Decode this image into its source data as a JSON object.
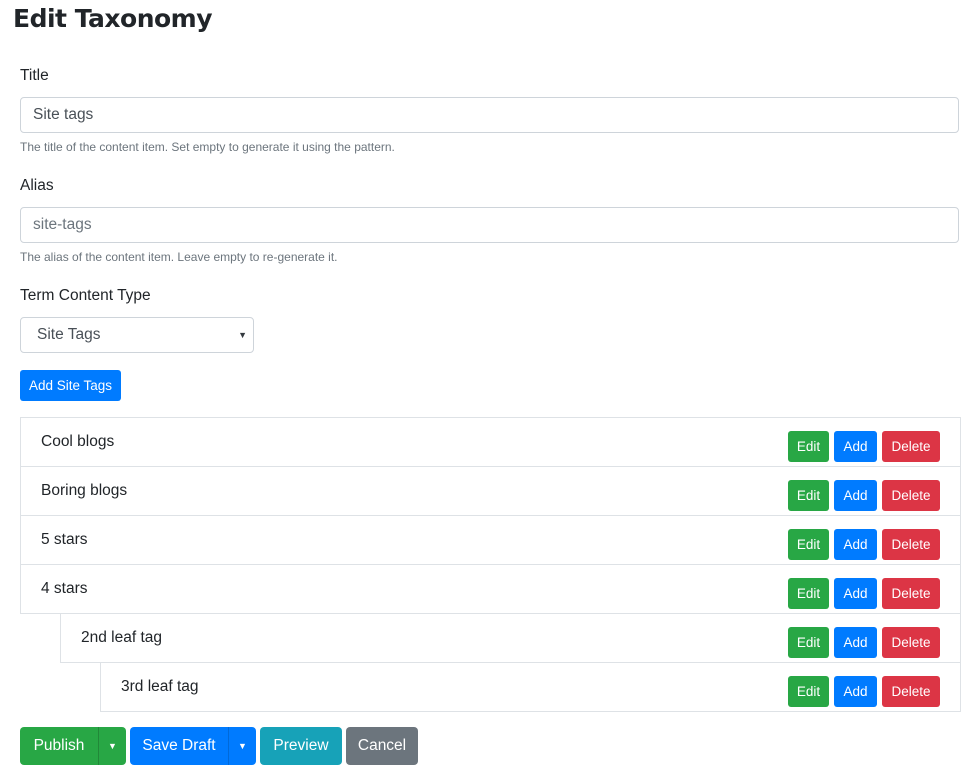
{
  "page": {
    "title": "Edit Taxonomy"
  },
  "form": {
    "title_field": {
      "label": "Title",
      "value": "Site tags",
      "placeholder": "",
      "hint": "The title of the content item. Set empty to generate it using the pattern."
    },
    "alias_field": {
      "label": "Alias",
      "value": "",
      "placeholder": "site-tags",
      "hint": "The alias of the content item. Leave empty to re-generate it."
    },
    "term_content_type": {
      "label": "Term Content Type",
      "selected": "Site Tags"
    },
    "add_button_label": "Add Site Tags"
  },
  "terms": [
    {
      "name": "Cool blogs",
      "level": 0,
      "edit": "Edit",
      "add": "Add",
      "delete": "Delete"
    },
    {
      "name": "Boring blogs",
      "level": 0,
      "edit": "Edit",
      "add": "Add",
      "delete": "Delete"
    },
    {
      "name": "5 stars",
      "level": 0,
      "edit": "Edit",
      "add": "Add",
      "delete": "Delete"
    },
    {
      "name": "4 stars",
      "level": 0,
      "edit": "Edit",
      "add": "Add",
      "delete": "Delete"
    },
    {
      "name": "2nd leaf tag",
      "level": 1,
      "edit": "Edit",
      "add": "Add",
      "delete": "Delete"
    },
    {
      "name": "3rd leaf tag",
      "level": 2,
      "edit": "Edit",
      "add": "Add",
      "delete": "Delete"
    }
  ],
  "footer": {
    "publish": "Publish",
    "save_draft": "Save Draft",
    "preview": "Preview",
    "cancel": "Cancel"
  },
  "icons": {
    "select_caret": "caret-down-icon",
    "dropdown_toggle": "caret-down-icon"
  },
  "colors": {
    "primary": "#007bff",
    "success": "#28a745",
    "danger": "#dc3545",
    "info": "#17a2b8",
    "secondary": "#6c757d",
    "border": "#dee2e6"
  }
}
